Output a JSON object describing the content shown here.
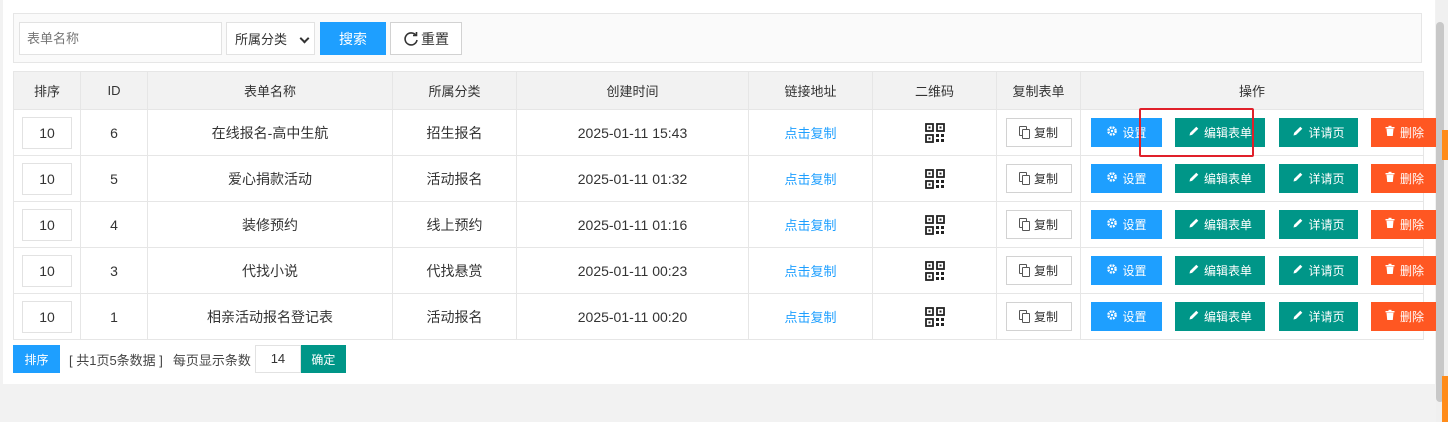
{
  "filter": {
    "name_placeholder": "表单名称",
    "category_selected": "所属分类",
    "search_label": "搜索",
    "reset_label": "重置"
  },
  "table": {
    "headers": {
      "sort": "排序",
      "id": "ID",
      "name": "表单名称",
      "category": "所属分类",
      "created": "创建时间",
      "link": "链接地址",
      "qrcode": "二维码",
      "copy": "复制表单",
      "actions": "操作"
    },
    "rows": [
      {
        "sort": "10",
        "id": "6",
        "name": "在线报名-高中生航",
        "category": "招生报名",
        "created": "2025-01-11 15:43",
        "link": "点击复制",
        "copy": "复制"
      },
      {
        "sort": "10",
        "id": "5",
        "name": "爱心捐款活动",
        "category": "活动报名",
        "created": "2025-01-11 01:32",
        "link": "点击复制",
        "copy": "复制"
      },
      {
        "sort": "10",
        "id": "4",
        "name": "装修预约",
        "category": "线上预约",
        "created": "2025-01-11 01:16",
        "link": "点击复制",
        "copy": "复制"
      },
      {
        "sort": "10",
        "id": "3",
        "name": "代找小说",
        "category": "代找悬赏",
        "created": "2025-01-11 00:23",
        "link": "点击复制",
        "copy": "复制"
      },
      {
        "sort": "10",
        "id": "1",
        "name": "相亲活动报名登记表",
        "category": "活动报名",
        "created": "2025-01-11 00:20",
        "link": "点击复制",
        "copy": "复制"
      }
    ],
    "action_labels": {
      "settings": "设置",
      "edit": "编辑表单",
      "detail": "详请页",
      "delete": "删除"
    }
  },
  "footer": {
    "sort_button": "排序",
    "pager_info": "[ 共1页5条数据 ]",
    "per_page_label": "每页显示条数",
    "per_page_value": "14",
    "confirm_button": "确定"
  },
  "colors": {
    "primary": "#1e9fff",
    "teal": "#009688",
    "danger": "#ff5722",
    "highlight": "#e0202a"
  }
}
